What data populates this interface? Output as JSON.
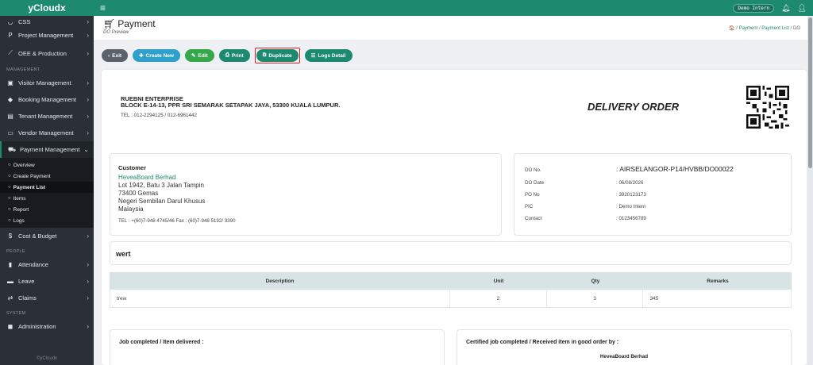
{
  "app": {
    "brand": "yCloudx",
    "footer": "©yCloudx"
  },
  "topbar": {
    "user_pill": "Demo Intern"
  },
  "sidebar": {
    "top_items": [
      {
        "label": "CSS"
      },
      {
        "label": "Project Management"
      },
      {
        "label": "OEE & Production"
      }
    ],
    "section_management": "MANAGEMENT",
    "management_items": [
      {
        "label": "Visitor Management"
      },
      {
        "label": "Booking Management"
      },
      {
        "label": "Tenant Management"
      },
      {
        "label": "Vendor Management"
      },
      {
        "label": "Payment Management"
      }
    ],
    "payment_sub": [
      {
        "label": "Overview"
      },
      {
        "label": "Create Payment"
      },
      {
        "label": "Payment List"
      },
      {
        "label": "Items"
      },
      {
        "label": "Report"
      },
      {
        "label": "Logs"
      }
    ],
    "cost_item": {
      "label": "Cost & Budget"
    },
    "section_people": "PEOPLE",
    "people_items": [
      {
        "label": "Attendance"
      },
      {
        "label": "Leave"
      },
      {
        "label": "Claims"
      }
    ],
    "section_system": "SYSTEM",
    "system_items": [
      {
        "label": "Administration"
      }
    ]
  },
  "header": {
    "title": "Payment",
    "subtitle": "DO Preview",
    "breadcrumb": {
      "home": "🏠",
      "sep": "/",
      "item1": "Payment",
      "item2": "Payment List",
      "current": "DO"
    }
  },
  "toolbar": {
    "exit": "Exit",
    "create_new": "Create New",
    "edit": "Edit",
    "print": "Print",
    "duplicate": "Duplicate",
    "logs_detail": "Logs Detail"
  },
  "document": {
    "company_name": "RUEBNI ENTERPRISE",
    "company_address": "BLOCK E-14-13, PPR SRI SEMARAK SETAPAK JAYA, 53300 KUALA LUMPUR.",
    "company_tel": "TEL : 012-2294125 / 012-6961442",
    "title": "DELIVERY ORDER",
    "customer": {
      "heading": "Customer",
      "name": "HeveaBoard Berhad",
      "address_lines": [
        "Lot 1942, Batu 3 Jalan Tampin",
        "73400 Gemas",
        "Negeri Sembilan Darul Khusus",
        "Malaysia"
      ],
      "tel": "TEL : +(60)7-948 4745/46   Fax : (60)7-948 5192/ 3390"
    },
    "info": [
      {
        "label": "DO No.",
        "value": ": AIRSELANGOR-P14/HVBB/DO00022"
      },
      {
        "label": "DO Date",
        "value": ": 06/08/2026"
      },
      {
        "label": "PO No",
        "value": ": 3920123173"
      },
      {
        "label": "PIC",
        "value": ": Demo Intern"
      },
      {
        "label": "Contact",
        "value": ": 0123456789"
      }
    ],
    "note": "wert",
    "table": {
      "headers": [
        "Description",
        "Unit",
        "Qty",
        "Remarks"
      ],
      "rows": [
        {
          "description": "trew",
          "unit": "2",
          "qty": "3",
          "remarks": "345"
        }
      ]
    },
    "signatures": {
      "left_title": "Job completed / Item delivered :",
      "right_title": "Certified job completed / Received item in good order by :",
      "right_company": "HeveaBoard Berhad"
    }
  },
  "colors": {
    "brand": "#1d8a70",
    "sidebar": "#2b3036",
    "highlight": "#e02020"
  }
}
